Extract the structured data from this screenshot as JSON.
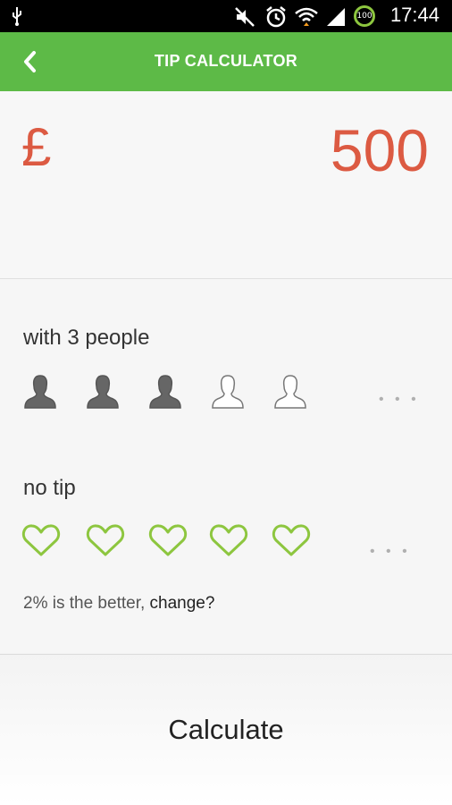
{
  "status_bar": {
    "time": "17:44",
    "battery_level": "100",
    "icons": [
      "usb-icon",
      "mute-icon",
      "alarm-icon",
      "wifi-icon",
      "signal-icon",
      "battery-icon"
    ]
  },
  "app_bar": {
    "title": "TIP CALCULATOR",
    "back_icon": "chevron-left-icon"
  },
  "amount": {
    "currency_symbol": "£",
    "value": "500",
    "color": "#dc5a42"
  },
  "people": {
    "label": "with 3 people",
    "selected": 3,
    "shown": 5,
    "more": "• • •"
  },
  "tip": {
    "label": "no tip",
    "shown": 5,
    "selected": 0,
    "more": "• • •",
    "accent": "#8dc63f"
  },
  "hint": {
    "text": "2% is the better, ",
    "link": "change?"
  },
  "calculate": {
    "label": "Calculate"
  },
  "colors": {
    "app_bar": "#5dba47",
    "accent": "#dc5a42"
  }
}
